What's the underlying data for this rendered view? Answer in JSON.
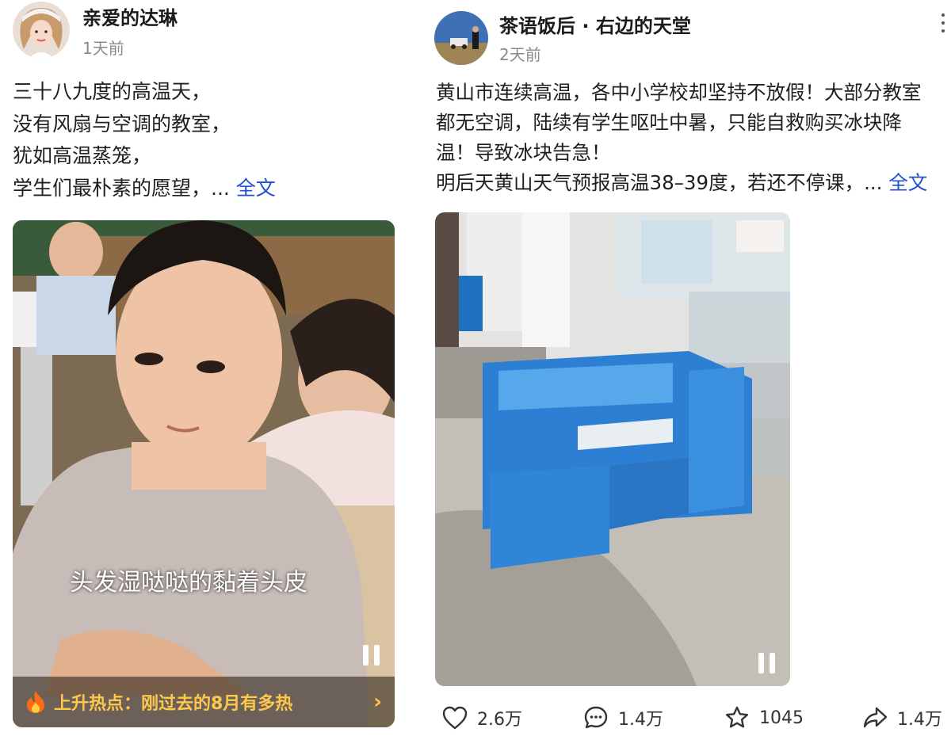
{
  "left_post": {
    "author_name": "亲爱的达琳",
    "time": "1天前",
    "lines": [
      "三十八九度的高温天，",
      "没有风扇与空调的教室，",
      "犹如高温蒸笼，",
      "学生们最朴素的愿望，..."
    ],
    "full_text_link": "全文",
    "video_caption": "头发湿哒哒的黏着头皮",
    "hot_topic": "上升热点：刚过去的8月有多热"
  },
  "right_post": {
    "author_name": "茶语饭后 · 右边的天堂",
    "time": "2天前",
    "lines": [
      "黄山市连续高温，各中小学校却坚持不放假！大部分教室",
      "都无空调，陆续有学生呕吐中暑，只能自救购买冰块降",
      "温！导致冰块告急！",
      "明后天黄山天气预报高温38–39度，若还不停课，..."
    ],
    "full_text_link": "全文",
    "actions": {
      "likes": "2.6万",
      "comments": "1.4万",
      "favorites": "1045",
      "shares": "1.4万"
    }
  },
  "icons": [
    "heart-icon",
    "comment-icon",
    "star-icon",
    "share-icon",
    "pause-icon",
    "fire-icon",
    "chevron-right-icon",
    "more-icon"
  ]
}
